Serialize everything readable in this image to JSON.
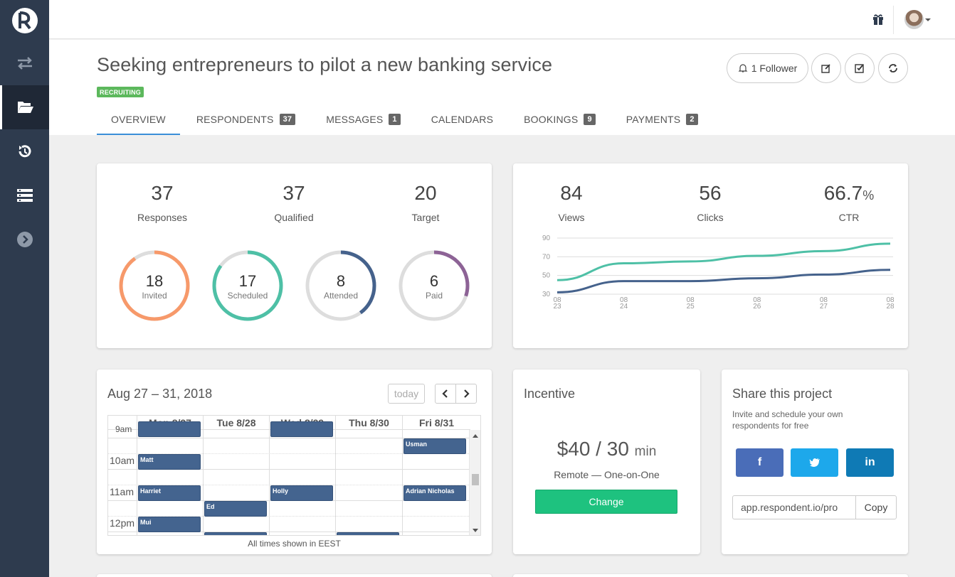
{
  "header": {
    "title": "Seeking entrepreneurs to pilot a new banking service",
    "status": "RECRUITING",
    "follower_label": "1 Follower"
  },
  "tabs": [
    {
      "label": "OVERVIEW",
      "count": ""
    },
    {
      "label": "RESPONDENTS",
      "count": "37"
    },
    {
      "label": "MESSAGES",
      "count": "1"
    },
    {
      "label": "CALENDARS",
      "count": ""
    },
    {
      "label": "BOOKINGS",
      "count": "9"
    },
    {
      "label": "PAYMENTS",
      "count": "2"
    }
  ],
  "stats": {
    "responses": {
      "value": "37",
      "label": "Responses"
    },
    "qualified": {
      "value": "37",
      "label": "Qualified"
    },
    "target": {
      "value": "20",
      "label": "Target"
    }
  },
  "rings": [
    {
      "value": "18",
      "label": "Invited",
      "fraction": 0.9,
      "color": "#f7996a"
    },
    {
      "value": "17",
      "label": "Scheduled",
      "fraction": 0.85,
      "color": "#4ec0a6"
    },
    {
      "value": "8",
      "label": "Attended",
      "fraction": 0.4,
      "color": "#45628c"
    },
    {
      "value": "6",
      "label": "Paid",
      "fraction": 0.3,
      "color": "#8d6396"
    }
  ],
  "metrics": {
    "views": {
      "value": "84",
      "label": "Views"
    },
    "clicks": {
      "value": "56",
      "label": "Clicks"
    },
    "ctr": {
      "value": "66.7",
      "unit": "%",
      "label": "CTR"
    }
  },
  "chart_data": {
    "type": "line",
    "x": [
      "08 23",
      "08 24",
      "08 25",
      "08 26",
      "08 27",
      "08 28"
    ],
    "x_ticks": [
      [
        "08",
        "23"
      ],
      [
        "08",
        "24"
      ],
      [
        "08",
        "25"
      ],
      [
        "08",
        "26"
      ],
      [
        "08",
        "27"
      ],
      [
        "08",
        "28"
      ]
    ],
    "y_ticks": [
      "90",
      "70",
      "50",
      "30"
    ],
    "ylim": [
      30,
      90
    ],
    "series": [
      {
        "color": "#4ec0a6",
        "values": [
          45,
          63,
          65,
          71,
          76,
          84
        ]
      },
      {
        "color": "#45628c",
        "values": [
          32,
          44,
          44,
          47,
          51,
          56
        ]
      }
    ],
    "grid": true
  },
  "calendar": {
    "range_title": "Aug 27 – 31, 2018",
    "today_label": "today",
    "days": [
      "Mon 8/27",
      "Tue 8/28",
      "Wed 8/29",
      "Thu 8/30",
      "Fri 8/31"
    ],
    "times": [
      "9am",
      "10am",
      "11am",
      "12pm"
    ],
    "events": {
      "usman": "Usman",
      "matt": "Matt",
      "harriet": "Harriet",
      "holly": "Holly",
      "adrian": "Adrian Nicholas",
      "ed": "Ed",
      "mui": "Mui"
    },
    "timezone_note": "All times shown in EEST"
  },
  "incentive": {
    "title": "Incentive",
    "amount": "$40 / 30",
    "unit": "min",
    "mode": "Remote — One-on-One",
    "change_label": "Change"
  },
  "share": {
    "title": "Share this project",
    "description": "Invite and schedule your own respondents for free",
    "facebook": "f",
    "linkedin": "in",
    "url": "app.respondent.io/pro",
    "copy_label": "Copy"
  },
  "icons": {
    "sidebar": [
      "transfer-icon",
      "folder-open-icon",
      "history-icon",
      "list-icon",
      "chevron-right-circle-icon"
    ]
  }
}
